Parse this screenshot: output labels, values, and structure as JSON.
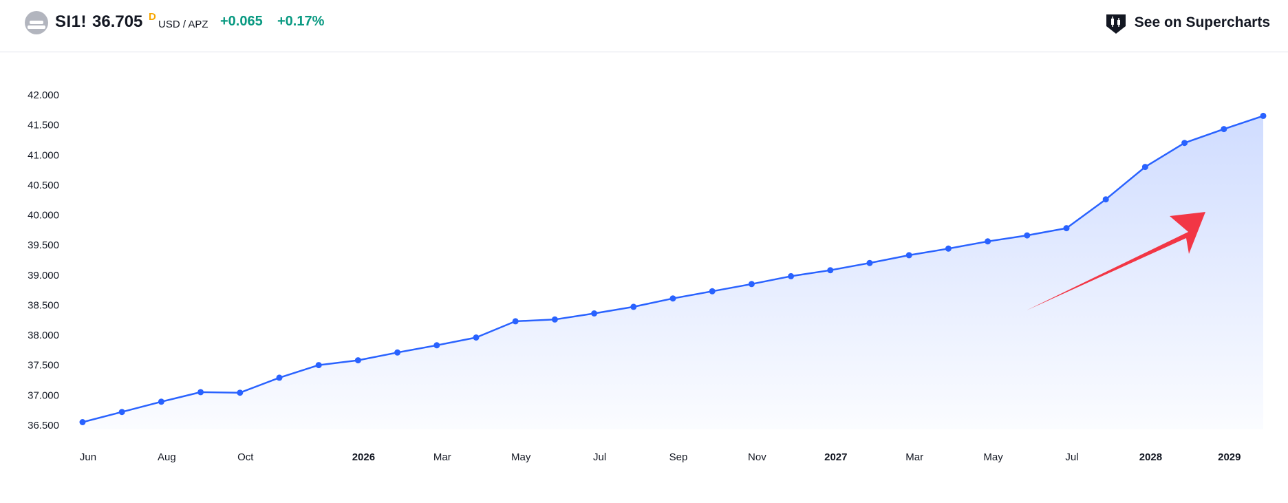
{
  "header": {
    "ticker": "SI1!",
    "price": "36.705",
    "price_flag": "D",
    "currency": "USD / APZ",
    "change_abs": "+0.065",
    "change_pct": "+0.17%",
    "supercharts_label": "See on Supercharts",
    "symbol_icon": "silver-bars-icon",
    "supercharts_icon": "tradingview-logo-icon"
  },
  "colors": {
    "line": "#2962ff",
    "positive": "#089981",
    "flag": "#f7a600",
    "arrow": "#f23645"
  },
  "chart_data": {
    "type": "line",
    "title": "",
    "xlabel": "",
    "ylabel": "",
    "ylim": [
      36.5,
      42.0
    ],
    "grid": false,
    "y_ticks": [
      "42.000",
      "41.500",
      "41.000",
      "40.500",
      "40.000",
      "39.500",
      "39.000",
      "38.500",
      "38.000",
      "37.500",
      "37.000",
      "36.500"
    ],
    "x_ticks": [
      {
        "label": "Jun",
        "month": 0,
        "bold": false
      },
      {
        "label": "Aug",
        "month": 2,
        "bold": false
      },
      {
        "label": "Oct",
        "month": 4,
        "bold": false
      },
      {
        "label": "2026",
        "month": 7,
        "bold": true
      },
      {
        "label": "Mar",
        "month": 9,
        "bold": false
      },
      {
        "label": "May",
        "month": 11,
        "bold": false
      },
      {
        "label": "Jul",
        "month": 13,
        "bold": false
      },
      {
        "label": "Sep",
        "month": 15,
        "bold": false
      },
      {
        "label": "Nov",
        "month": 17,
        "bold": false
      },
      {
        "label": "2027",
        "month": 19,
        "bold": true
      },
      {
        "label": "Mar",
        "month": 21,
        "bold": false
      },
      {
        "label": "May",
        "month": 23,
        "bold": false
      },
      {
        "label": "Jul",
        "month": 25,
        "bold": false
      },
      {
        "label": "2028",
        "month": 27,
        "bold": true
      },
      {
        "label": "2029",
        "month": 29,
        "bold": true
      }
    ],
    "series": [
      {
        "x": [
          0,
          1,
          2,
          3,
          4,
          5,
          6,
          7,
          8,
          9,
          10,
          11,
          12,
          13,
          14,
          15,
          16,
          17,
          18,
          19,
          20,
          21,
          22,
          23,
          24,
          25,
          26,
          27,
          28,
          29,
          30
        ],
        "values": [
          36.54,
          36.71,
          36.88,
          37.04,
          37.03,
          37.28,
          37.49,
          37.57,
          37.7,
          37.82,
          37.95,
          38.22,
          38.25,
          38.35,
          38.46,
          38.6,
          38.72,
          38.84,
          38.97,
          39.07,
          39.19,
          39.32,
          39.43,
          39.55,
          39.65,
          39.77,
          40.25,
          40.79,
          41.19,
          41.42,
          41.64
        ]
      }
    ],
    "annotation": {
      "type": "arrow",
      "direction": "up-right",
      "color": "#f23645"
    }
  }
}
